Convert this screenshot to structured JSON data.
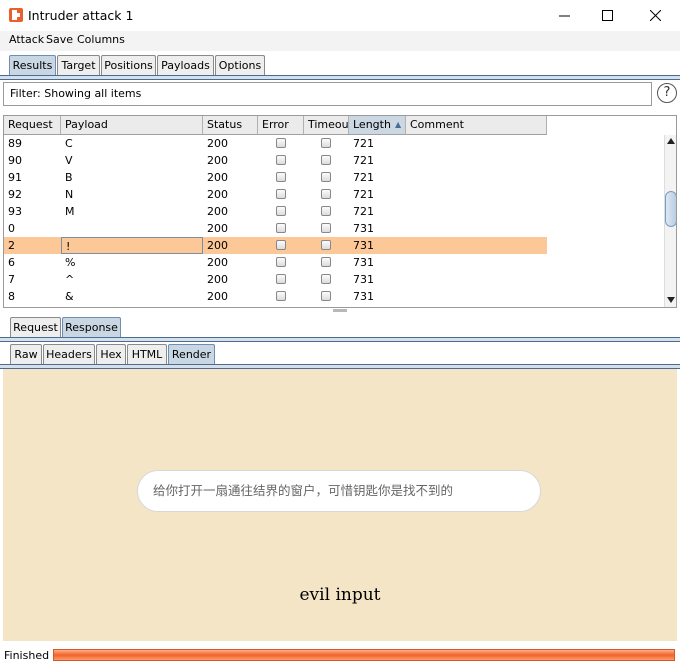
{
  "window": {
    "title": "Intruder attack 1"
  },
  "menu": [
    "Attack",
    "Save",
    "Columns"
  ],
  "main_tabs": [
    "Results",
    "Target",
    "Positions",
    "Payloads",
    "Options"
  ],
  "filter": {
    "text": "Filter: Showing all items",
    "help": "?"
  },
  "table": {
    "columns": [
      "Request",
      "Payload",
      "Status",
      "Error",
      "Timeout",
      "Length",
      "Comment"
    ],
    "sort_indicator": "▲",
    "rows": [
      {
        "request": "89",
        "payload": "C",
        "status": "200",
        "length": "721"
      },
      {
        "request": "90",
        "payload": "V",
        "status": "200",
        "length": "721"
      },
      {
        "request": "91",
        "payload": "B",
        "status": "200",
        "length": "721"
      },
      {
        "request": "92",
        "payload": "N",
        "status": "200",
        "length": "721"
      },
      {
        "request": "93",
        "payload": "M",
        "status": "200",
        "length": "721"
      },
      {
        "request": "0",
        "payload": "",
        "status": "200",
        "length": "731"
      },
      {
        "request": "2",
        "payload": "!",
        "status": "200",
        "length": "731",
        "selected": true
      },
      {
        "request": "6",
        "payload": "%",
        "status": "200",
        "length": "731"
      },
      {
        "request": "7",
        "payload": "^",
        "status": "200",
        "length": "731"
      },
      {
        "request": "8",
        "payload": "&",
        "status": "200",
        "length": "731"
      }
    ]
  },
  "message_tabs": [
    "Request",
    "Response"
  ],
  "view_tabs": [
    "Raw",
    "Headers",
    "Hex",
    "HTML",
    "Render"
  ],
  "render": {
    "input_placeholder": "给你打开一扇通往结界的窗户，可惜钥匙你是找不到的",
    "text": "evil input"
  },
  "status": {
    "label": "Finished"
  },
  "colors": {
    "selected_row": "#fdc898",
    "render_bg": "#f4e5c7",
    "progress": "#f0642a",
    "active_tab": "#c9d6e3"
  }
}
